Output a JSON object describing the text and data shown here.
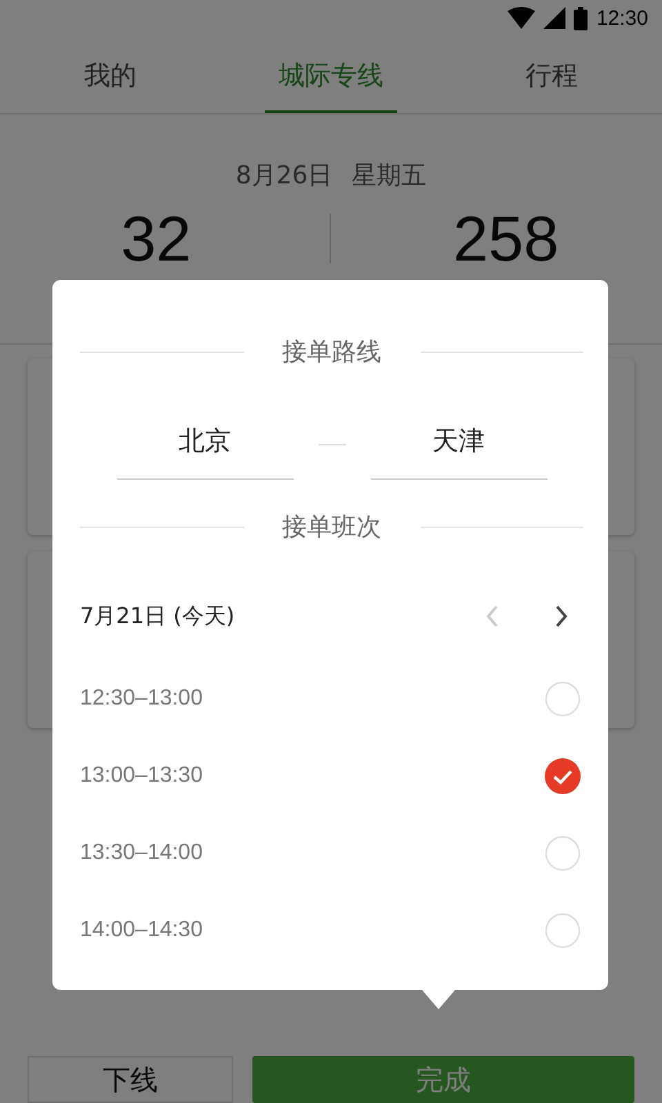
{
  "status_bar": {
    "time": "12:30"
  },
  "tabs": [
    {
      "label": "我的",
      "selected": false
    },
    {
      "label": "城际专线",
      "selected": true
    },
    {
      "label": "行程",
      "selected": false
    }
  ],
  "date": {
    "day": "8月26日",
    "weekday": "星期五"
  },
  "stats": [
    "32",
    "258"
  ],
  "dialog": {
    "route_title": "接单路线",
    "from": "北京",
    "to": "天津",
    "schedule_title": "接单班次",
    "date": "7月21日 (今天)",
    "prev_disabled": true,
    "next_disabled": false,
    "slots": [
      {
        "time": "12:30–13:00",
        "selected": false
      },
      {
        "time": "13:00–13:30",
        "selected": true
      },
      {
        "time": "13:30–14:00",
        "selected": false
      },
      {
        "time": "14:00–14:30",
        "selected": false
      }
    ]
  },
  "buttons": [
    {
      "label": "下线",
      "kind": "secondary"
    },
    {
      "label": "完成",
      "kind": "primary"
    }
  ]
}
